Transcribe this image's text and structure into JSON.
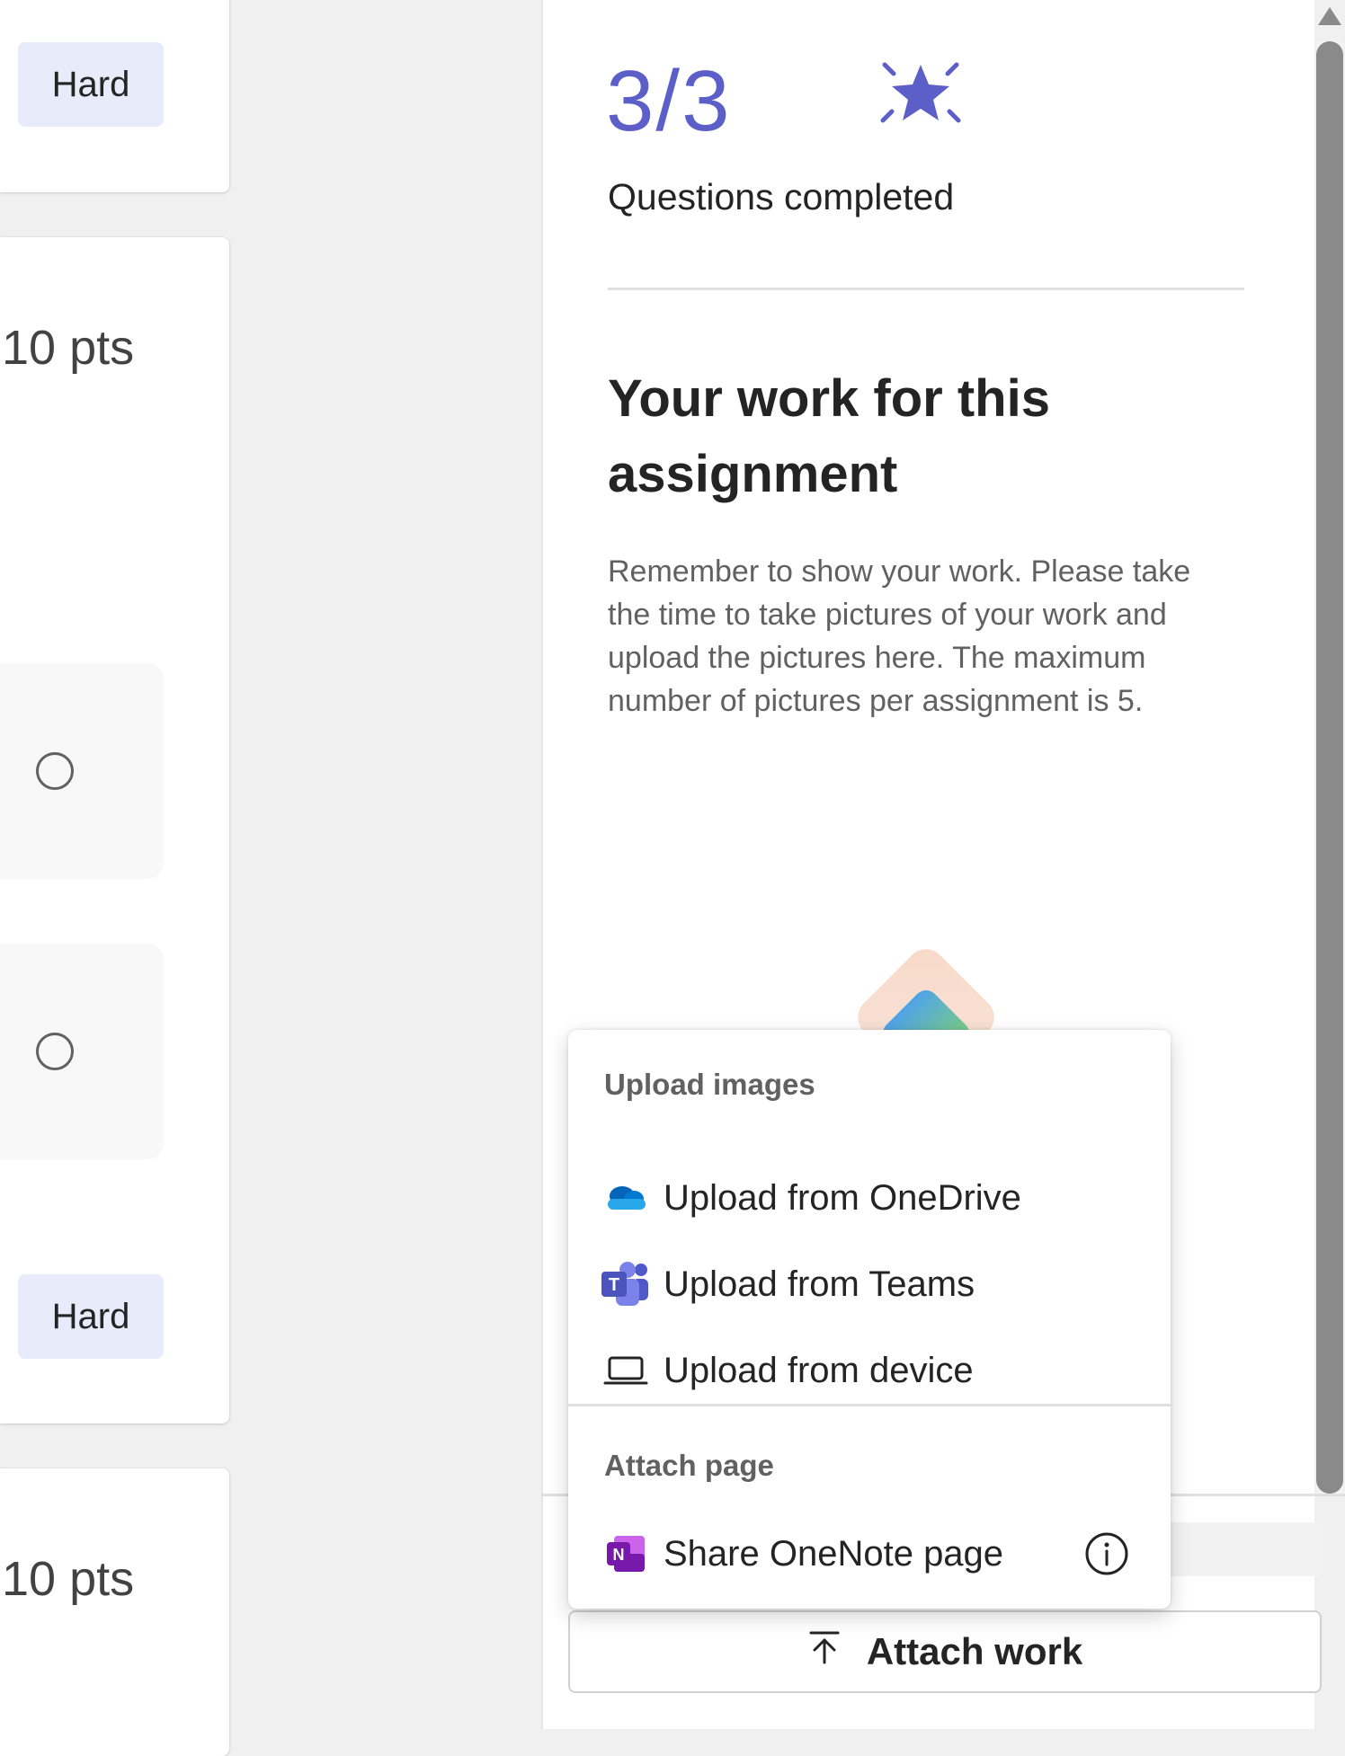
{
  "left_cards": {
    "card1": {
      "difficulty": "Hard"
    },
    "card2": {
      "points": "10 pts",
      "difficulty": "Hard"
    },
    "card3": {
      "points": "10 pts"
    }
  },
  "panel": {
    "score": "3/3",
    "score_caption": "Questions completed",
    "work_title": "Your work for this assignment",
    "work_description": "Remember to show your work. Please take the time to take pictures of your work and upload the pictures here. The maximum number of pictures per assignment is 5.",
    "accent_color": "#5b5fc7"
  },
  "attach_menu": {
    "upload_header": "Upload images",
    "items": [
      {
        "label": "Upload from OneDrive",
        "icon": "onedrive-icon"
      },
      {
        "label": "Upload from Teams",
        "icon": "teams-icon"
      },
      {
        "label": "Upload from device",
        "icon": "laptop-icon"
      }
    ],
    "attach_header": "Attach page",
    "onenote_item": {
      "label": "Share OneNote page",
      "icon": "onenote-icon"
    }
  },
  "footer": {
    "attach_button_label": "Attach work"
  }
}
